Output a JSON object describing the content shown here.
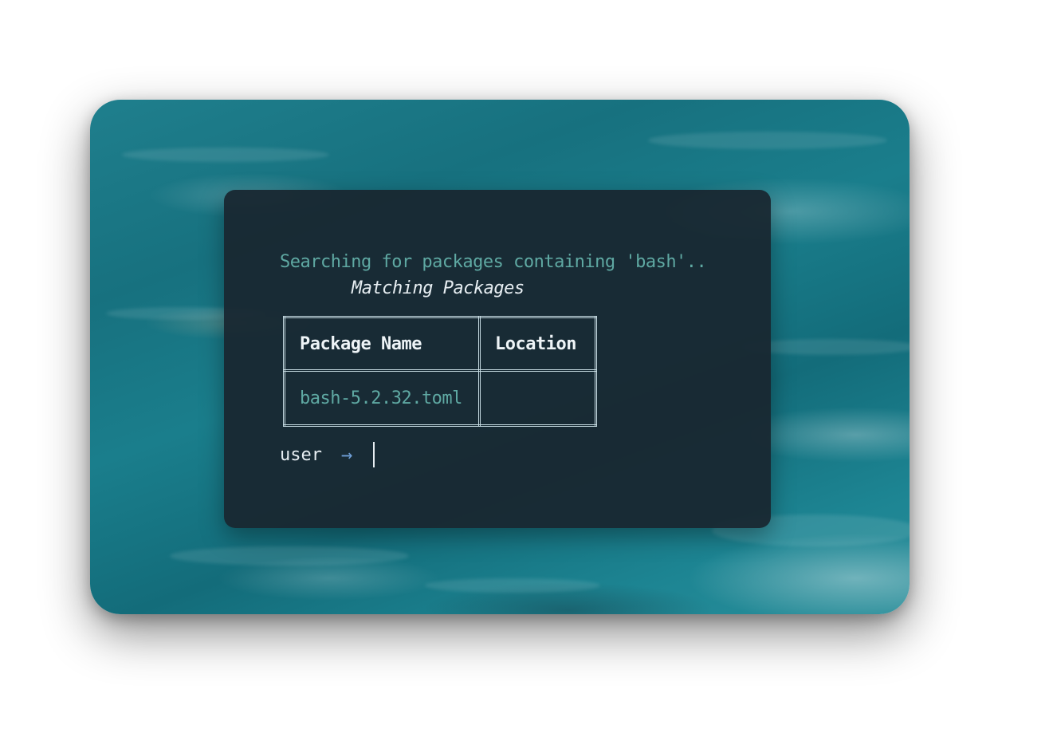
{
  "terminal": {
    "search_line": "Searching for packages containing 'bash'..",
    "table_title": "Matching Packages",
    "table": {
      "headers": [
        "Package Name",
        "Location"
      ],
      "rows": [
        [
          "bash-5.2.32.toml",
          ""
        ]
      ]
    },
    "prompt": {
      "user": "user",
      "arrow": "→",
      "input_value": ""
    }
  },
  "colors": {
    "terminal_bg": "#182630",
    "accent_teal": "#5fa9a3",
    "arrow_blue": "#6f9fd6",
    "text": "#e7eef2"
  }
}
